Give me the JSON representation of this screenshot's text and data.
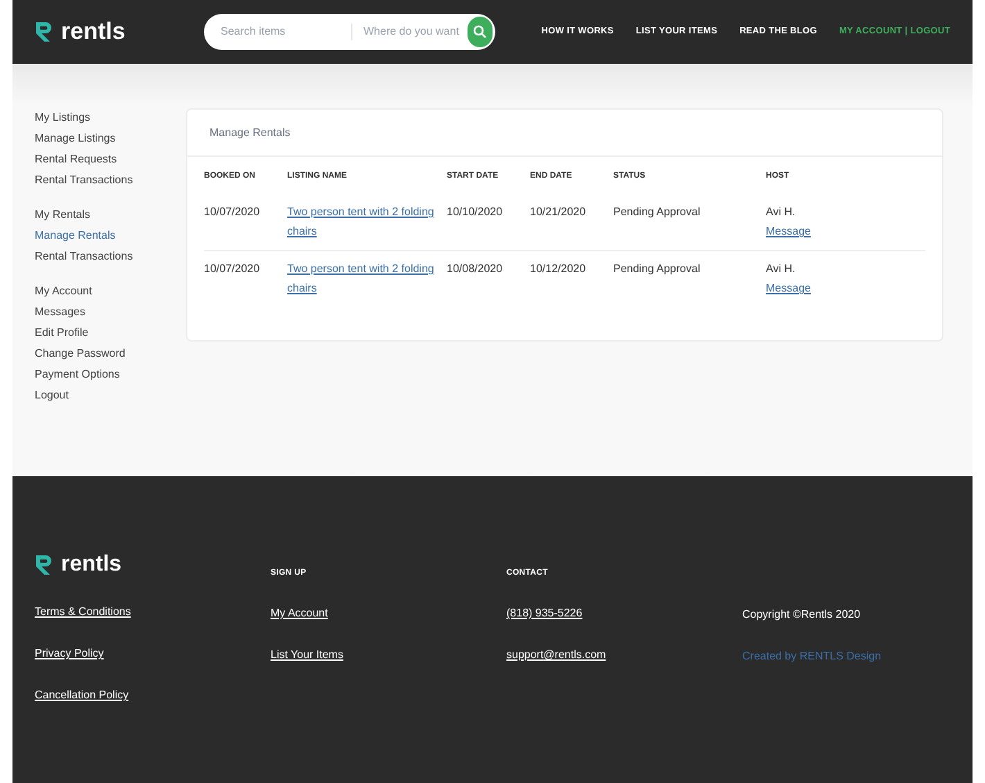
{
  "header": {
    "logo": "rentls",
    "search": {
      "placeholder": "Search items"
    },
    "location": {
      "placeholder": "Where do you want"
    },
    "nav": [
      {
        "label": "HOW IT WORKS",
        "kind": "plain"
      },
      {
        "label": "LIST YOUR ITEMS",
        "kind": "plain"
      },
      {
        "label": "READ THE BLOG",
        "kind": "plain"
      },
      {
        "label": "MY ACCOUNT | LOGOUT",
        "kind": "accent"
      }
    ]
  },
  "sidebar": {
    "groups": [
      {
        "items": [
          {
            "label": "My Listings",
            "selected": false
          },
          {
            "label": "Manage Listings",
            "selected": false
          },
          {
            "label": "Rental Requests",
            "selected": false
          },
          {
            "label": "Rental Transactions",
            "selected": false
          }
        ]
      },
      {
        "items": [
          {
            "label": "My Rentals",
            "selected": false
          },
          {
            "label": "Manage Rentals",
            "selected": true
          },
          {
            "label": "Rental Transactions",
            "selected": false
          }
        ]
      },
      {
        "items": [
          {
            "label": "My Account",
            "selected": false
          },
          {
            "label": "Messages",
            "selected": false
          },
          {
            "label": "Edit Profile",
            "selected": false
          },
          {
            "label": "Change Password",
            "selected": false
          },
          {
            "label": "Payment Options",
            "selected": false
          },
          {
            "label": "Logout",
            "selected": false
          }
        ]
      }
    ]
  },
  "panel": {
    "title": "Manage Rentals",
    "table": {
      "columns": [
        "BOOKED ON",
        "LISTING NAME",
        "START DATE",
        "END DATE",
        "STATUS",
        "HOST"
      ],
      "rows": [
        {
          "booked_on": "10/07/2020",
          "listing": "Two person tent with 2 folding chairs",
          "start": "10/10/2020",
          "end": "10/21/2020",
          "status": "Pending Approval",
          "host": "Avi H.",
          "action": "Message"
        },
        {
          "booked_on": "10/07/2020",
          "listing": "Two person tent with 2 folding chairs",
          "start": "10/08/2020",
          "end": "10/12/2020",
          "status": "Pending Approval",
          "host": "Avi H.",
          "action": "Message"
        }
      ]
    }
  },
  "footer": {
    "logo": "rentls",
    "links": [
      "Terms & Conditions",
      "Privacy Policy",
      "Cancellation Policy"
    ],
    "sign_up": {
      "heading": "SIGN UP",
      "links": [
        "My Account",
        "List Your Items"
      ]
    },
    "contact": {
      "heading": "CONTACT",
      "links": [
        "(818) 935-5226",
        "support@rentls.com"
      ]
    },
    "copyright": "Copyright ©Rentls 2020",
    "credit": "Created by RENTLS Design"
  }
}
